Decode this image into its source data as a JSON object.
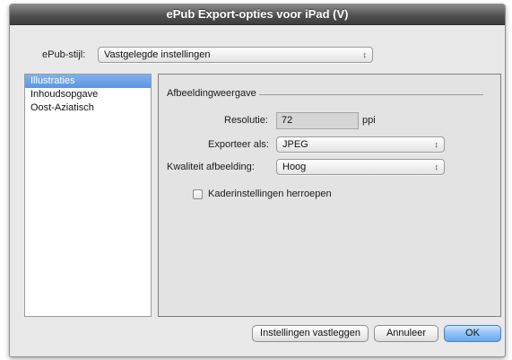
{
  "window": {
    "title": "ePub Export-opties voor iPad (V)"
  },
  "style_row": {
    "label": "ePub-stijl:",
    "selected": "Vastgelegde instellingen"
  },
  "sidebar": {
    "items": [
      {
        "label": "Illustraties",
        "selected": true
      },
      {
        "label": "Inhoudsopgave",
        "selected": false
      },
      {
        "label": "Oost-Aziatisch",
        "selected": false
      }
    ]
  },
  "panel": {
    "section_title": "Afbeeldingweergave",
    "resolution": {
      "label": "Resolutie:",
      "value": "72",
      "unit": "ppi"
    },
    "export_as": {
      "label": "Exporteer als:",
      "selected": "JPEG"
    },
    "quality": {
      "label": "Kwaliteit afbeelding:",
      "selected": "Hoog"
    },
    "checkbox": {
      "label": "Kaderinstellingen herroepen",
      "checked": false
    }
  },
  "buttons": {
    "save": "Instellingen vastleggen",
    "cancel": "Annuleer",
    "ok": "OK"
  },
  "colors": {
    "selection": "#6fa3e8",
    "default_button": "#8ec0f6",
    "title_bar": "#4e4e4e"
  }
}
